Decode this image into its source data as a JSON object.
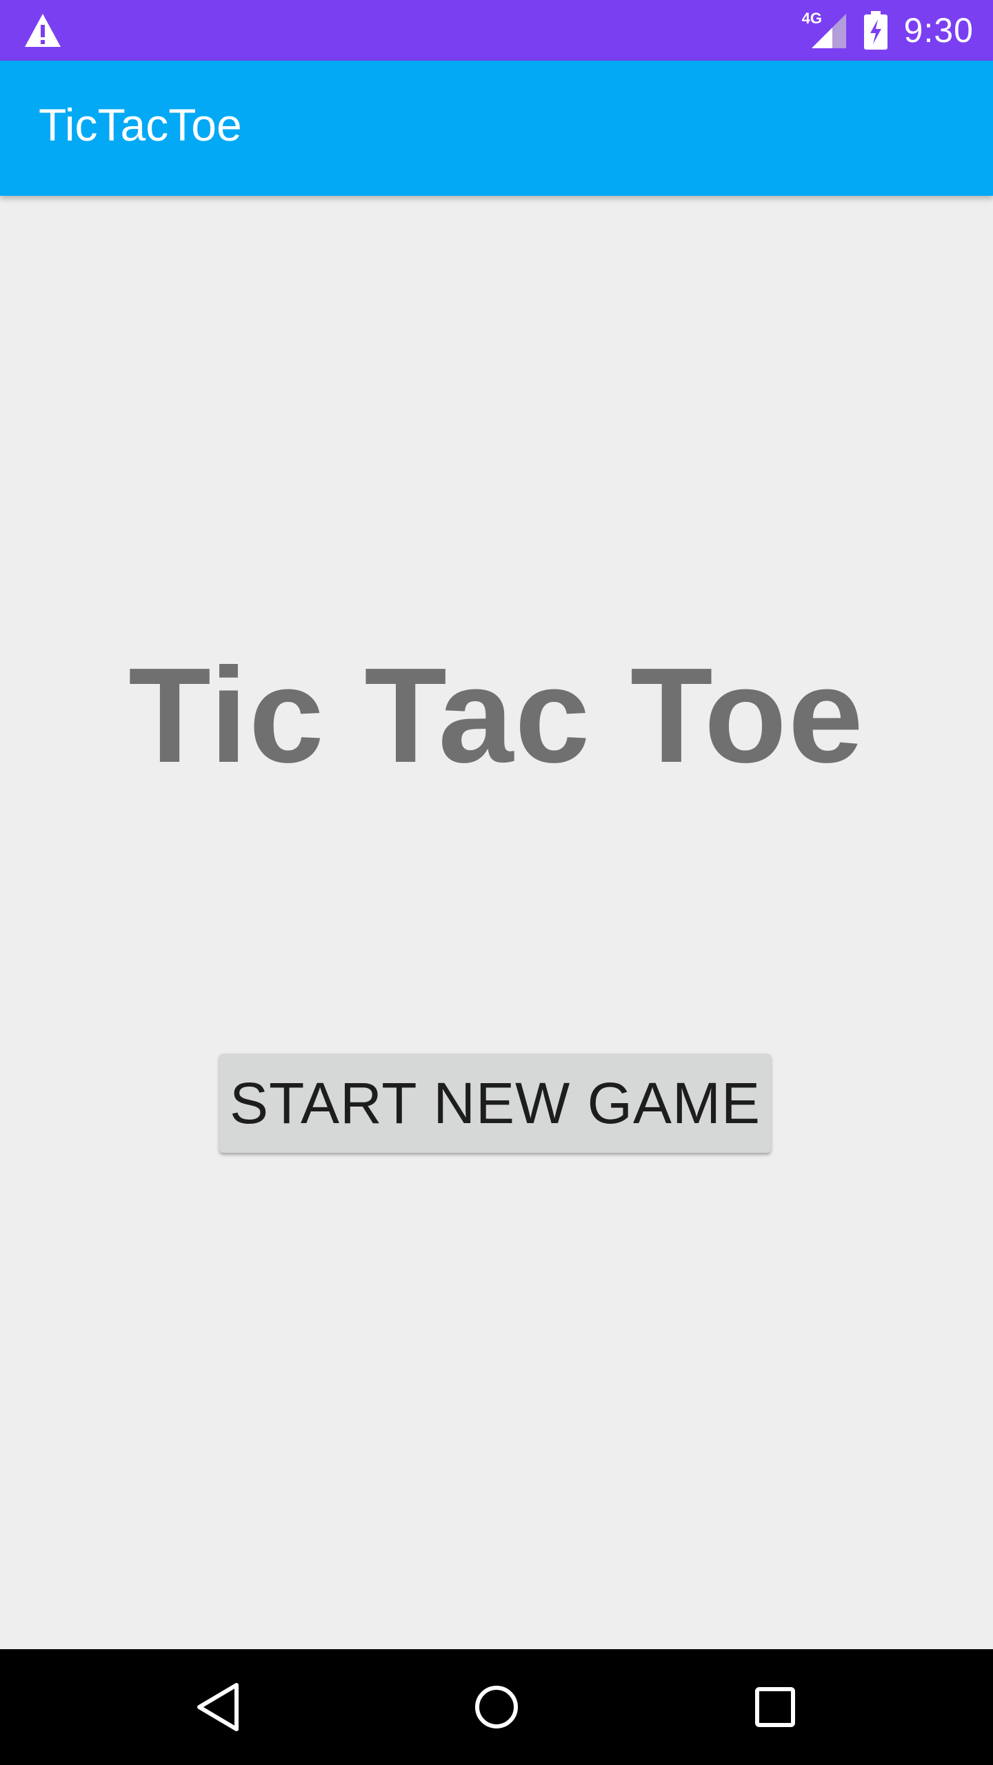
{
  "status_bar": {
    "time": "9:30",
    "network_label": "4G",
    "icons": {
      "warning": "warning-icon",
      "signal": "signal-icon",
      "battery": "battery-charging-icon"
    },
    "background_color": "#7b3ff2"
  },
  "app_bar": {
    "title": "TicTacToe",
    "background_color": "#03a9f4"
  },
  "main": {
    "game_title": "Tic Tac Toe",
    "start_button_label": "START NEW GAME"
  },
  "nav_bar": {
    "icons": [
      "back-icon",
      "home-icon",
      "recents-icon"
    ]
  }
}
